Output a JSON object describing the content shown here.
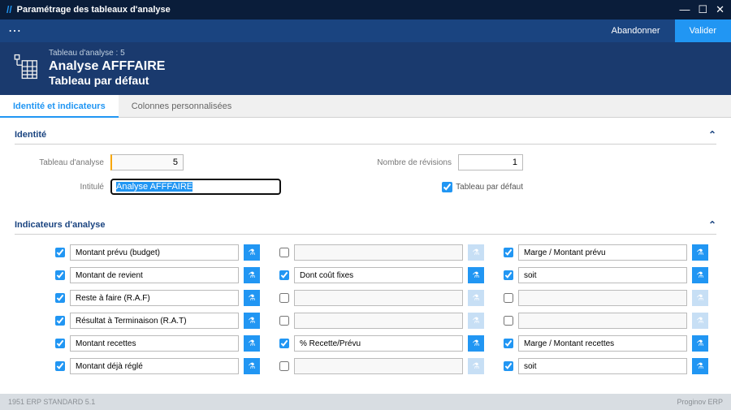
{
  "window": {
    "title": "Paramétrage des tableaux d'analyse",
    "abandon": "Abandonner",
    "validate": "Valider"
  },
  "header": {
    "subtitle": "Tableau d'analyse : 5",
    "title": "Analyse AFFFAIRE",
    "subtitle2": "Tableau par défaut"
  },
  "tabs": {
    "identity": "Identité et indicateurs",
    "columns": "Colonnes personnalisées"
  },
  "identity": {
    "section_title": "Identité",
    "table_label": "Tableau d'analyse",
    "table_value": "5",
    "revisions_label": "Nombre de révisions",
    "revisions_value": "1",
    "intitule_label": "Intitulé",
    "intitule_value": "Analyse AFFFAIRE",
    "default_label": "Tableau par défaut",
    "default_checked": true
  },
  "indicators": {
    "section_title": "Indicateurs d'analyse",
    "rows": [
      {
        "c1": {
          "checked": true,
          "label": "Montant prévu (budget)",
          "action": true
        },
        "c2": {
          "checked": false,
          "label": "",
          "action": false
        },
        "c3": {
          "checked": true,
          "label": "Marge / Montant prévu",
          "action": true
        }
      },
      {
        "c1": {
          "checked": true,
          "label": "Montant de revient",
          "action": true
        },
        "c2": {
          "checked": true,
          "label": "Dont coût fixes",
          "action": true
        },
        "c3": {
          "checked": true,
          "label": "soit",
          "action": true
        }
      },
      {
        "c1": {
          "checked": true,
          "label": "Reste à faire (R.A.F)",
          "action": true
        },
        "c2": {
          "checked": false,
          "label": "",
          "action": false
        },
        "c3": {
          "checked": false,
          "label": "",
          "action": false
        }
      },
      {
        "c1": {
          "checked": true,
          "label": "Résultat à Terminaison (R.A.T)",
          "action": true
        },
        "c2": {
          "checked": false,
          "label": "",
          "action": false
        },
        "c3": {
          "checked": false,
          "label": "",
          "action": false
        }
      },
      {
        "c1": {
          "checked": true,
          "label": "Montant recettes",
          "action": true
        },
        "c2": {
          "checked": true,
          "label": "% Recette/Prévu",
          "action": true
        },
        "c3": {
          "checked": true,
          "label": "Marge / Montant recettes",
          "action": true
        }
      },
      {
        "c1": {
          "checked": true,
          "label": "Montant déjà réglé",
          "action": true
        },
        "c2": {
          "checked": false,
          "label": "",
          "action": false
        },
        "c3": {
          "checked": true,
          "label": "soit",
          "action": true
        }
      }
    ]
  },
  "footer": {
    "left": "1951 ERP STANDARD 5.1",
    "right": "Proginov ERP"
  }
}
